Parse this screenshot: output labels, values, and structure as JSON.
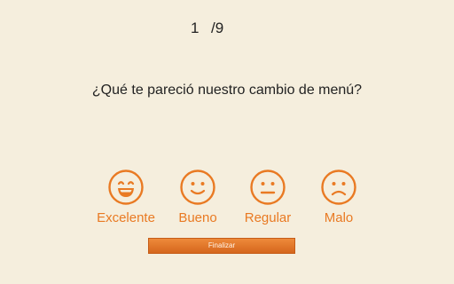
{
  "survey": {
    "progress_current": "1",
    "progress_total": "/9",
    "question": "¿Qué te pareció nuestro cambio de menú?",
    "options": [
      {
        "label": "Excelente",
        "icon": "laughing-face-icon"
      },
      {
        "label": "Bueno",
        "icon": "smiling-face-icon"
      },
      {
        "label": "Regular",
        "icon": "neutral-face-icon"
      },
      {
        "label": "Malo",
        "icon": "sad-face-icon"
      }
    ],
    "finish_label": "Finalizar"
  },
  "colors": {
    "background": "#f5eedd",
    "accent": "#e97a23",
    "text": "#222222"
  }
}
